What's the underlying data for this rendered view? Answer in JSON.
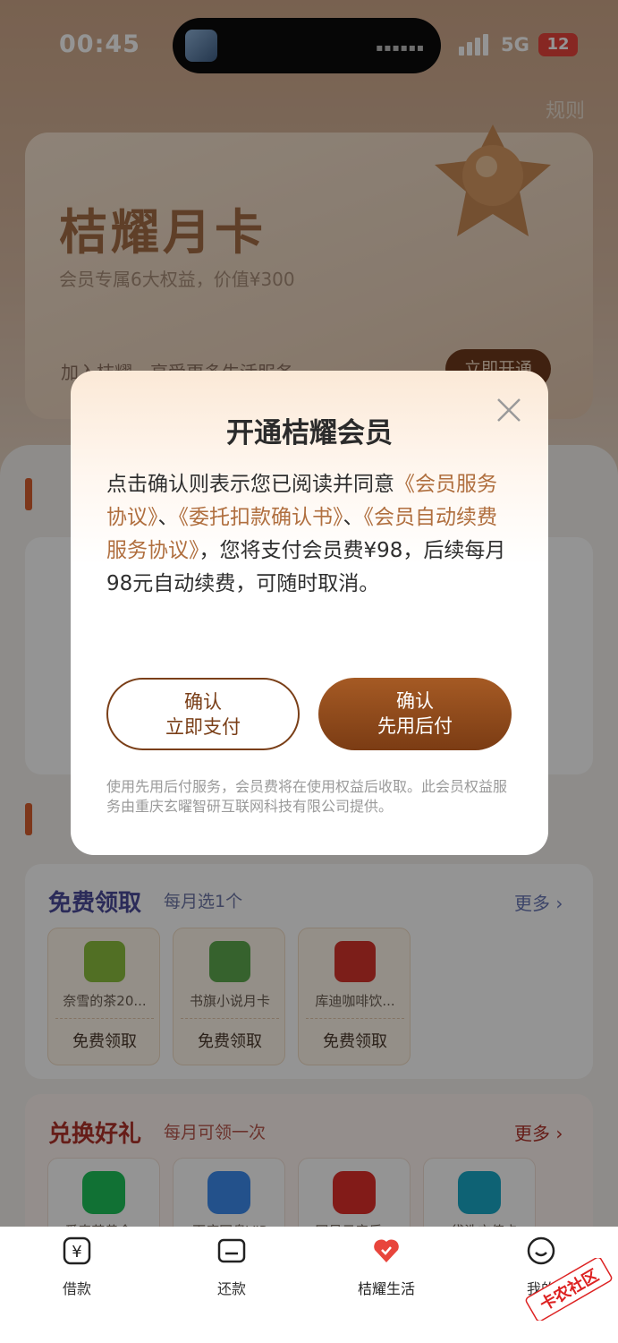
{
  "status_bar": {
    "time": "00:45",
    "network": "5G",
    "battery": "12"
  },
  "header": {
    "rules_label": "规则"
  },
  "member_card": {
    "title": "桔耀月卡",
    "subtitle": "会员专属6大权益，价值¥300",
    "join_text": "加入桔耀，享受更多生活服务",
    "cta_label": "立即开通"
  },
  "sections": {
    "free": {
      "title": "免费领取",
      "subtitle": "每月选1个",
      "more_label": "更多",
      "items": [
        {
          "name": "奈雪的茶20...",
          "action": "免费领取",
          "color": "#8cbf3f"
        },
        {
          "name": "书旗小说月卡",
          "action": "免费领取",
          "color": "#5da94e"
        },
        {
          "name": "库迪咖啡饮...",
          "action": "免费领取",
          "color": "#d6342c"
        }
      ]
    },
    "redeem": {
      "title": "兑换好礼",
      "subtitle": "每月可领一次",
      "more_label": "更多",
      "items": [
        {
          "name": "爱奇艺黄金...",
          "color": "#1ec35b"
        },
        {
          "name": "百度网盘VIP",
          "color": "#3d8cf0"
        },
        {
          "name": "网易云音乐...",
          "color": "#e1302a"
        },
        {
          "name": "e袋洗充值卡",
          "color": "#19a9c8"
        }
      ]
    }
  },
  "modal": {
    "title": "开通桔耀会员",
    "body_prefix": "点击确认则表示您已阅读并同意",
    "link1": "《会员服务协议》",
    "sep1": "、",
    "link2": "《委托扣款确认书》",
    "sep2": "、",
    "link3": "《会员自动续费服务协议》",
    "body_suffix": "，您将支付会员费¥98，后续每月98元自动续费，可随时取消。",
    "btn_pay_line1": "确认",
    "btn_pay_line2": "立即支付",
    "btn_later_line1": "确认",
    "btn_later_line2": "先用后付",
    "note": "使用先用后付服务，会员费将在使用权益后收取。此会员权益服务由重庆玄曜智研互联网科技有限公司提供。"
  },
  "tabbar": {
    "items": [
      {
        "label": "借款"
      },
      {
        "label": "还款"
      },
      {
        "label": "桔耀生活"
      },
      {
        "label": "我的"
      }
    ]
  },
  "watermark": {
    "text": "卡农社区"
  },
  "colors": {
    "accent": "#7a3f18",
    "link": "#b06f3f",
    "active_tab": "#e8453c"
  }
}
